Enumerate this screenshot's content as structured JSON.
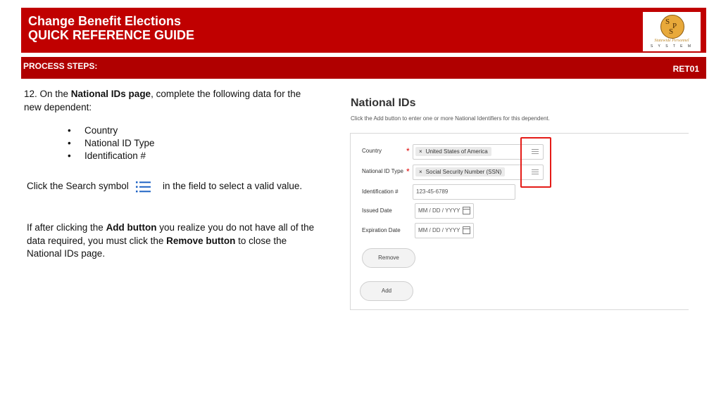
{
  "header": {
    "title_line1": "Change Benefit Elections",
    "title_line2": "QUICK REFERENCE GUIDE"
  },
  "logo": {
    "letters": [
      "S",
      "P",
      "S"
    ],
    "line1": "Statewide Personnel",
    "line2": "S Y S T E M"
  },
  "process_bar": {
    "label": "PROCESS STEPS:",
    "code": "RET01"
  },
  "instructions": {
    "step_prefix": "12.  On the ",
    "step_bold": "National IDs page",
    "step_suffix": ", complete the following data for the new dependent:",
    "bullets": [
      "Country",
      "National ID Type",
      "Identification #"
    ],
    "search_before": "Click the Search symbol",
    "search_after": "in the field to select a valid value.",
    "note_1": "If after clicking the ",
    "note_bold_1": "Add button",
    "note_2": " you realize you do not have all of the data required, you must click the ",
    "note_bold_2": "Remove button",
    "note_3": " to close the National IDs page."
  },
  "screenshot": {
    "title": "National IDs",
    "subtitle": "Click the Add button to enter one or more National Identifiers for this dependent.",
    "country_label": "Country",
    "country_value": "United States of America",
    "id_type_label": "National ID Type",
    "id_type_value": "Social Security Number (SSN)",
    "identification_label": "Identification #",
    "identification_value": "123-45-6789",
    "issued_label": "Issued Date",
    "issued_placeholder": "MM / DD / YYYY",
    "expiration_label": "Expiration Date",
    "expiration_placeholder": "MM / DD / YYYY",
    "remove_label": "Remove",
    "add_label": "Add",
    "required_mark": "*",
    "remove_x": "×"
  },
  "colors": {
    "header_red": "#c00000",
    "bar_red": "#b00000",
    "highlight": "#e41b17"
  }
}
